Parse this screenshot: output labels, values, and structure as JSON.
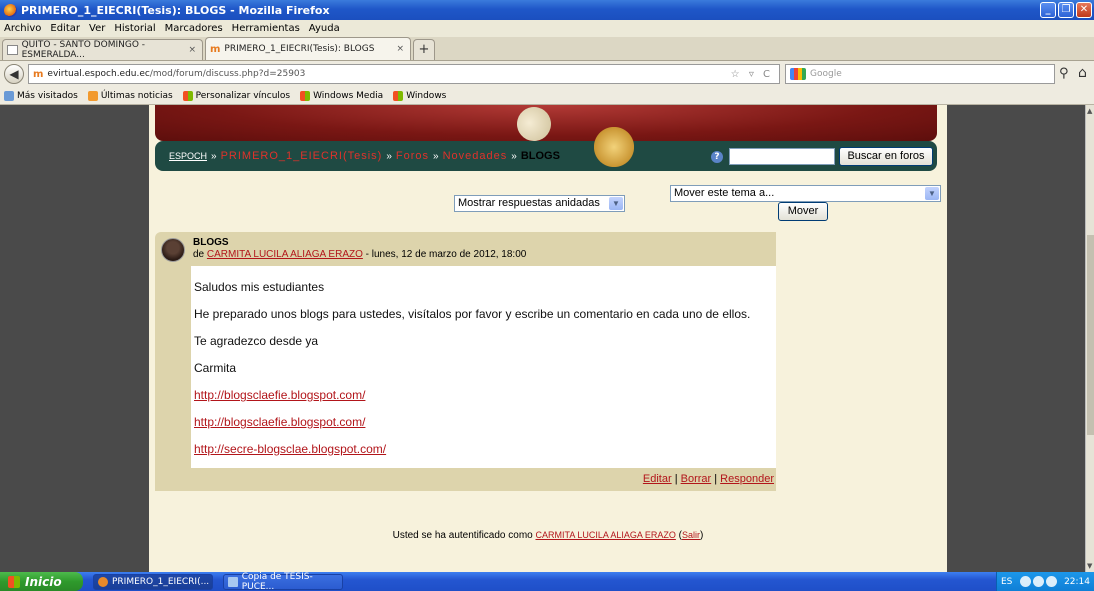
{
  "window": {
    "title": "PRIMERO_1_EIECRI(Tesis): BLOGS - Mozilla Firefox",
    "buttons": [
      "_",
      "❐",
      "✕"
    ]
  },
  "menu": [
    "Archivo",
    "Editar",
    "Ver",
    "Historial",
    "Marcadores",
    "Herramientas",
    "Ayuda"
  ],
  "tabs": [
    {
      "label": "QUITO - SANTO DOMINGO - ESMERALDA...",
      "close": "×"
    },
    {
      "label": "PRIMERO_1_EIECRI(Tesis): BLOGS",
      "close": "×"
    }
  ],
  "newtab": "+",
  "nav": {
    "url_host": "evirtual.espoch.edu.ec",
    "url_path": "/mod/forum/discuss.php?d=25903",
    "url_icons": "☆ ▿ C",
    "search_placeholder": "Google"
  },
  "bookmarks": [
    "Más visitados",
    "Últimas noticias",
    "Personalizar vínculos",
    "Windows Media",
    "Windows"
  ],
  "page": {
    "breadcrumb": {
      "root": "ESPOCH",
      "course": "PRIMERO_1_EIECRI(Tesis)",
      "forums": "Foros",
      "forum": "Novedades",
      "current": "BLOGS",
      "sep": "»"
    },
    "search_forum_button": "Buscar en foros",
    "display_mode": "Mostrar respuestas anidadas",
    "move_select": "Mover este tema a...",
    "move_button": "Mover",
    "post": {
      "subject": "BLOGS",
      "author_prefix": "de",
      "author": "CARMITA LUCILA ALIAGA ERAZO",
      "date": " - lunes, 12 de marzo de 2012, 18:00",
      "body": [
        "Saludos mis estudiantes",
        "He preparado unos blogs para ustedes, visítalos por favor y escribe un comentario en cada uno de ellos.",
        "Te agradezco desde ya",
        "Carmita"
      ],
      "links": [
        "http://blogsclaefie.blogspot.com/",
        "http://blogsclaefie.blogspot.com/",
        "http://secre-blogsclae.blogspot.com/"
      ],
      "actions": {
        "edit": "Editar",
        "delete": "Borrar",
        "reply": "Responder",
        "sep": "|"
      }
    },
    "login": {
      "prefix": "Usted se ha autentificado como",
      "user": "CARMITA LUCILA ALIAGA ERAZO",
      "logout": "Salir",
      "open_paren": "(",
      "close_paren": ")"
    }
  },
  "taskbar": {
    "start": "Inicio",
    "items": [
      "PRIMERO_1_EIECRI(...",
      "Copia de TESIS-PUCE..."
    ],
    "lang": "ES",
    "time": "22:14"
  }
}
